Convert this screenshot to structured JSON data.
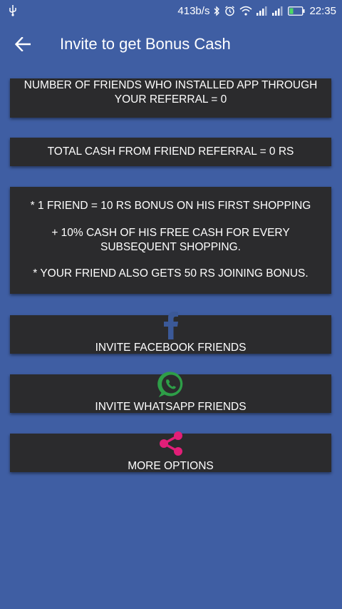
{
  "status_bar": {
    "usb_icon": "usb-icon",
    "net_speed": "413b/s",
    "time": "22:35",
    "icons": [
      "bluetooth-icon",
      "alarm-icon",
      "wifi-icon",
      "signal-icon",
      "signal-icon",
      "battery-icon"
    ]
  },
  "app_bar": {
    "back_icon": "arrow-left-icon",
    "title": "Invite to get Bonus Cash"
  },
  "referral_card": {
    "text": "NUMBER OF FRIENDS WHO INSTALLED APP THROUGH YOUR REFERRAL = 0"
  },
  "total_card": {
    "text": "TOTAL CASH FROM FRIEND REFERRAL = 0 RS"
  },
  "bonus_card": {
    "line1": "* 1 FRIEND = 10 RS BONUS ON HIS FIRST SHOPPING",
    "line2": "+ 10% CASH OF HIS FREE CASH FOR EVERY SUBSEQUENT SHOPPING.",
    "line3": "* YOUR FRIEND ALSO GETS 50 RS JOINING BONUS."
  },
  "actions": {
    "facebook": {
      "icon": "facebook-icon",
      "label": "INVITE FACEBOOK FRIENDS",
      "color": "#3b5998"
    },
    "whatsapp": {
      "icon": "whatsapp-icon",
      "label": "INVITE WHATSAPP FRIENDS",
      "color": "#2e9e48"
    },
    "more": {
      "icon": "share-icon",
      "label": "MORE OPTIONS",
      "color": "#e21e78"
    }
  },
  "colors": {
    "background": "#3f5ea3",
    "card": "#2b2b2d",
    "text": "#ffffff"
  }
}
